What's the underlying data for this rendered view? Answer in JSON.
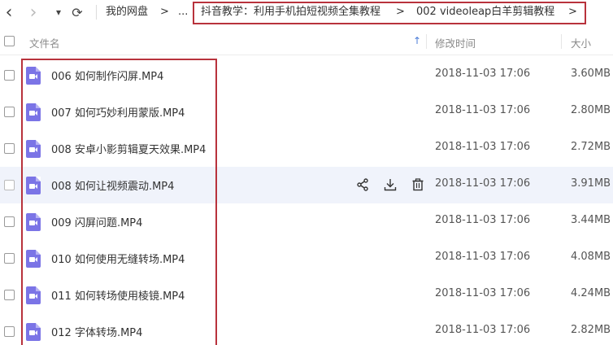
{
  "toolbar": {
    "back_glyph": "‹",
    "forward_glyph": "›",
    "dropdown_glyph": "▾",
    "refresh_glyph": "⟳",
    "root_label": "我的网盘",
    "arrow_glyph": ">",
    "ellipsis": "...",
    "crumb_1": "抖音教学：利用手机拍短视频全集教程",
    "crumb_2": "002 videoleap白羊剪辑教程"
  },
  "header": {
    "name_label": "文件名",
    "sort_glyph": "↑",
    "date_label": "修改时间",
    "size_label": "大小"
  },
  "colors": {
    "highlight_border": "#b8323c",
    "file_icon": "#7b74e6",
    "hover_row": "#f0f3fb"
  },
  "files": [
    {
      "name": "006 如何制作闪屏.MP4",
      "date": "2018-11-03 17:06",
      "size": "3.60MB"
    },
    {
      "name": "007 如何巧妙利用蒙版.MP4",
      "date": "2018-11-03 17:06",
      "size": "2.80MB"
    },
    {
      "name": "008 安卓小影剪辑夏天效果.MP4",
      "date": "2018-11-03 17:06",
      "size": "2.72MB"
    },
    {
      "name": "008 如何让视频震动.MP4",
      "date": "2018-11-03 17:06",
      "size": "3.91MB"
    },
    {
      "name": "009 闪屏问题.MP4",
      "date": "2018-11-03 17:06",
      "size": "3.44MB"
    },
    {
      "name": "010 如何使用无缝转场.MP4",
      "date": "2018-11-03 17:06",
      "size": "4.08MB"
    },
    {
      "name": "011 如何转场使用棱镜.MP4",
      "date": "2018-11-03 17:06",
      "size": "4.24MB"
    },
    {
      "name": "012 字体转场.MP4",
      "date": "2018-11-03 17:06",
      "size": "2.82MB"
    }
  ]
}
